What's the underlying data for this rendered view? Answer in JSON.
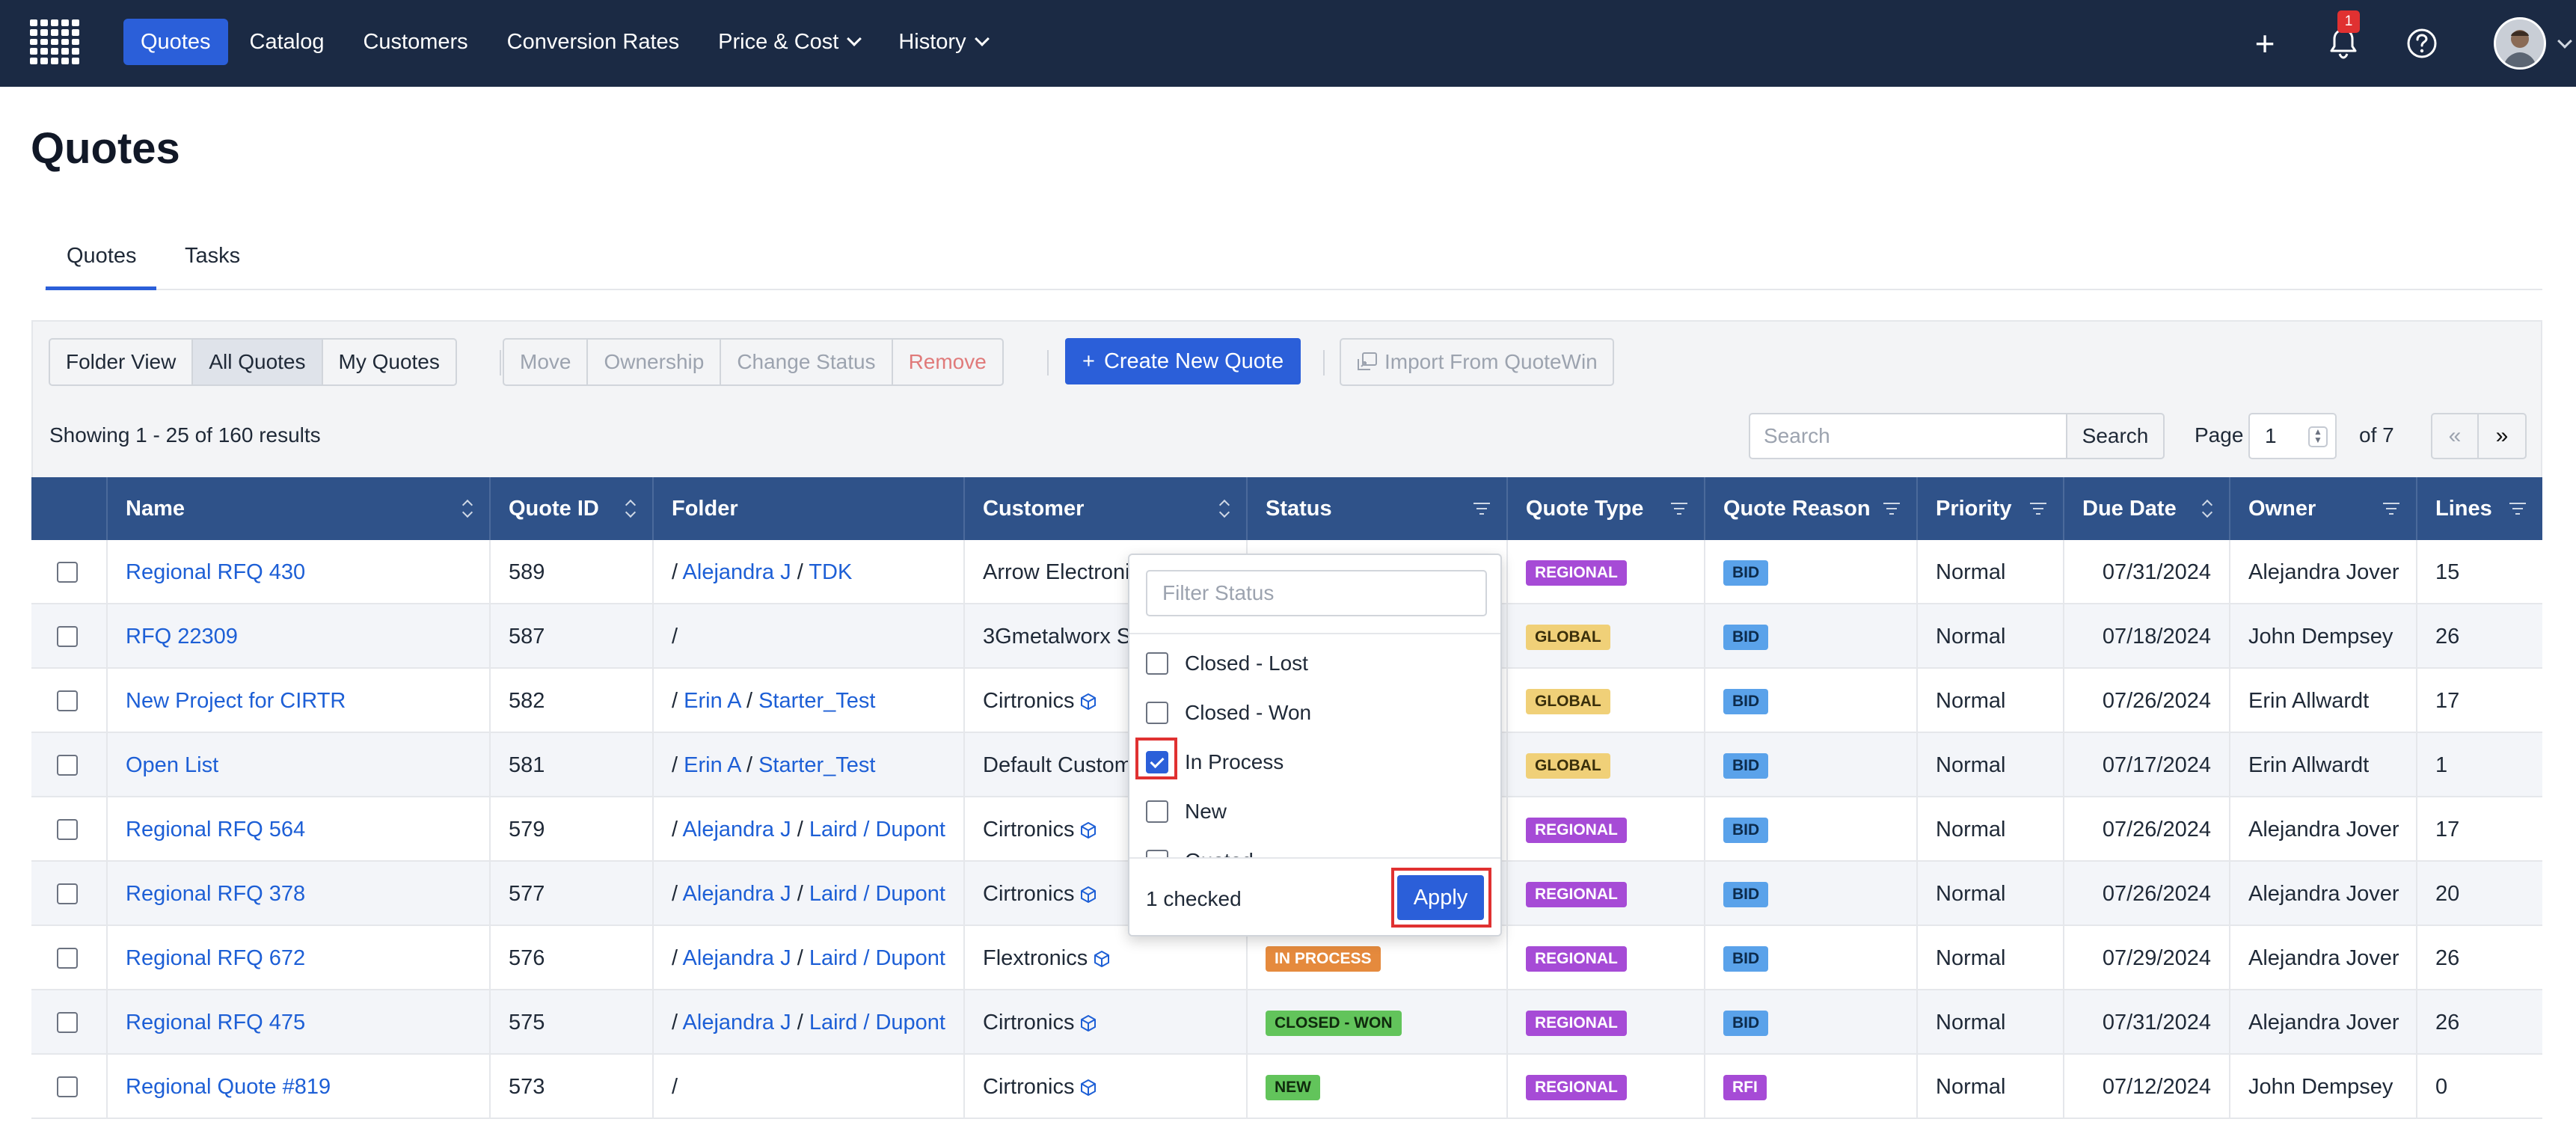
{
  "nav": {
    "links": [
      {
        "label": "Quotes",
        "active": true
      },
      {
        "label": "Catalog"
      },
      {
        "label": "Customers"
      },
      {
        "label": "Conversion Rates"
      },
      {
        "label": "Price & Cost",
        "dropdown": true
      },
      {
        "label": "History",
        "dropdown": true
      }
    ],
    "notification_count": "1",
    "icons": [
      "plus-icon",
      "bell-icon",
      "help-icon",
      "avatar",
      "chevron-down-icon"
    ]
  },
  "page": {
    "title": "Quotes",
    "tabs": [
      "Quotes",
      "Tasks"
    ],
    "active_tab": "Quotes"
  },
  "toolbar": {
    "views": [
      "Folder View",
      "All Quotes",
      "My Quotes"
    ],
    "selected_view": "All Quotes",
    "actions": [
      "Move",
      "Ownership",
      "Change Status",
      "Remove"
    ],
    "create_label": "Create New Quote",
    "import_label": "Import From QuoteWin",
    "results_text": "Showing 1 - 25 of 160 results",
    "search_placeholder": "Search",
    "search_button": "Search",
    "page_label": "Page",
    "page_value": "1",
    "page_of": "of 7",
    "prev": "«",
    "next": "»"
  },
  "table": {
    "columns": [
      "Name",
      "Quote ID",
      "Folder",
      "Customer",
      "Status",
      "Quote Type",
      "Quote Reason",
      "Priority",
      "Due Date",
      "Owner",
      "Lines"
    ],
    "rows": [
      {
        "name": "Regional RFQ 430",
        "id": "589",
        "folder": [
          "Alejandra J",
          "TDK"
        ],
        "customer": "Arrow Electroni",
        "cube": false,
        "status": "",
        "type": "REGIONAL",
        "reason": "BID",
        "priority": "Normal",
        "due": "07/31/2024",
        "owner": "Alejandra Jover",
        "lines": "15"
      },
      {
        "name": "RFQ 22309",
        "id": "587",
        "folder": [],
        "customer": "3Gmetalworx S",
        "cube": false,
        "status": "",
        "type": "GLOBAL",
        "reason": "BID",
        "priority": "Normal",
        "due": "07/18/2024",
        "owner": "John Dempsey",
        "lines": "26"
      },
      {
        "name": "New Project for CIRTR",
        "id": "582",
        "folder": [
          "Erin A",
          "Starter_Test"
        ],
        "customer": "Cirtronics",
        "cube": true,
        "status": "",
        "type": "GLOBAL",
        "reason": "BID",
        "priority": "Normal",
        "due": "07/26/2024",
        "owner": "Erin Allwardt",
        "lines": "17"
      },
      {
        "name": "Open List",
        "id": "581",
        "folder": [
          "Erin A",
          "Starter_Test"
        ],
        "customer": "Default Custom",
        "cube": false,
        "status": "",
        "type": "GLOBAL",
        "reason": "BID",
        "priority": "Normal",
        "due": "07/17/2024",
        "owner": "Erin Allwardt",
        "lines": "1"
      },
      {
        "name": "Regional RFQ 564",
        "id": "579",
        "folder": [
          "Alejandra J",
          "Laird / Dupont"
        ],
        "customer": "Cirtronics",
        "cube": true,
        "status": "",
        "type": "REGIONAL",
        "reason": "BID",
        "priority": "Normal",
        "due": "07/26/2024",
        "owner": "Alejandra Jover",
        "lines": "17"
      },
      {
        "name": "Regional RFQ 378",
        "id": "577",
        "folder": [
          "Alejandra J",
          "Laird / Dupont"
        ],
        "customer": "Cirtronics",
        "cube": true,
        "status": "",
        "type": "REGIONAL",
        "reason": "BID",
        "priority": "Normal",
        "due": "07/26/2024",
        "owner": "Alejandra Jover",
        "lines": "20"
      },
      {
        "name": "Regional RFQ 672",
        "id": "576",
        "folder": [
          "Alejandra J",
          "Laird / Dupont"
        ],
        "customer": "Flextronics",
        "cube": true,
        "status": "IN PROCESS",
        "type": "REGIONAL",
        "reason": "BID",
        "priority": "Normal",
        "due": "07/29/2024",
        "owner": "Alejandra Jover",
        "lines": "26"
      },
      {
        "name": "Regional RFQ 475",
        "id": "575",
        "folder": [
          "Alejandra J",
          "Laird / Dupont"
        ],
        "customer": "Cirtronics",
        "cube": true,
        "status": "CLOSED - WON",
        "type": "REGIONAL",
        "reason": "BID",
        "priority": "Normal",
        "due": "07/31/2024",
        "owner": "Alejandra Jover",
        "lines": "26"
      },
      {
        "name": "Regional Quote #819",
        "id": "573",
        "folder": [],
        "customer": "Cirtronics",
        "cube": true,
        "status": "NEW",
        "type": "REGIONAL",
        "reason": "RFI",
        "priority": "Normal",
        "due": "07/12/2024",
        "owner": "John Dempsey",
        "lines": "0"
      }
    ]
  },
  "status_filter": {
    "placeholder": "Filter Status",
    "options": [
      {
        "label": "Closed - Lost",
        "checked": false
      },
      {
        "label": "Closed - Won",
        "checked": false
      },
      {
        "label": "In Process",
        "checked": true
      },
      {
        "label": "New",
        "checked": false
      },
      {
        "label": "Quoted",
        "checked": false
      }
    ],
    "checked_text": "1 checked",
    "apply_label": "Apply"
  },
  "colors": {
    "nav_bg": "#1b2a44",
    "accent": "#2b5fd9",
    "table_header": "#2f5289",
    "link": "#1d5fd6",
    "highlight": "#e03131"
  }
}
